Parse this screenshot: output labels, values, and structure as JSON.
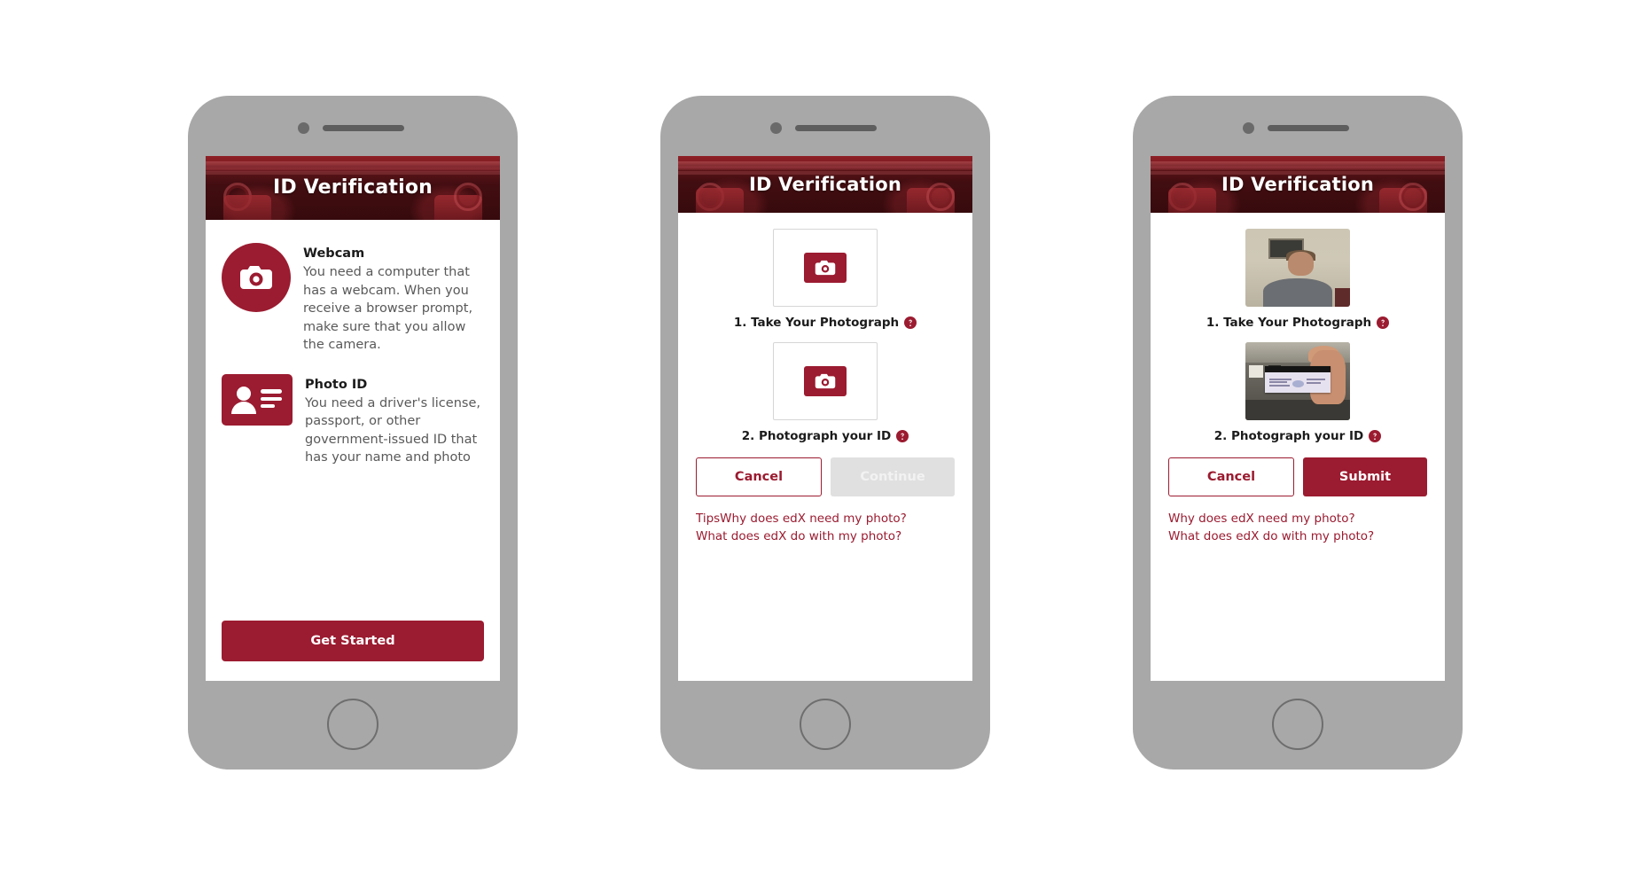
{
  "brand": {
    "accent": "#9b1b30",
    "banner_dark": "#5a1115",
    "phone_body": "#a8a8a8",
    "muted_text": "#595959",
    "disabled_button": "#e0e0e0"
  },
  "header": {
    "title": "ID Verification"
  },
  "screens": [
    {
      "id": "intro",
      "title": "ID Verification",
      "requirements": [
        {
          "icon": "camera-icon",
          "title": "Webcam",
          "description": "You need a computer that has a webcam. When you receive a browser prompt, make sure that you allow the camera."
        },
        {
          "icon": "photo-id-card-icon",
          "title": "Photo ID",
          "description": "You need a driver's license, passport, or other government-issued ID that has your name and photo"
        }
      ],
      "cta": "Get Started"
    },
    {
      "id": "capture-empty",
      "title": "ID Verification",
      "steps": [
        {
          "label": "1. Take Your Photograph",
          "icon": "camera-icon",
          "help": "help-icon",
          "filled": false
        },
        {
          "label": "2. Photograph your ID",
          "icon": "camera-icon",
          "help": "help-icon",
          "filled": false
        }
      ],
      "buttons": {
        "cancel": "Cancel",
        "primary": "Continue",
        "primary_disabled": true
      },
      "links": [
        "TipsWhy does edX need my photo?",
        "What does edX do with my photo?"
      ]
    },
    {
      "id": "capture-filled",
      "title": "ID Verification",
      "steps": [
        {
          "label": "1. Take Your Photograph",
          "icon": "selfie-photo",
          "help": "help-icon",
          "filled": true
        },
        {
          "label": "2. Photograph your ID",
          "icon": "id-card-photo",
          "help": "help-icon",
          "filled": true
        }
      ],
      "buttons": {
        "cancel": "Cancel",
        "primary": "Submit",
        "primary_disabled": false
      },
      "links": [
        "Why does edX need my photo?",
        "What does edX do with my photo?"
      ]
    }
  ]
}
